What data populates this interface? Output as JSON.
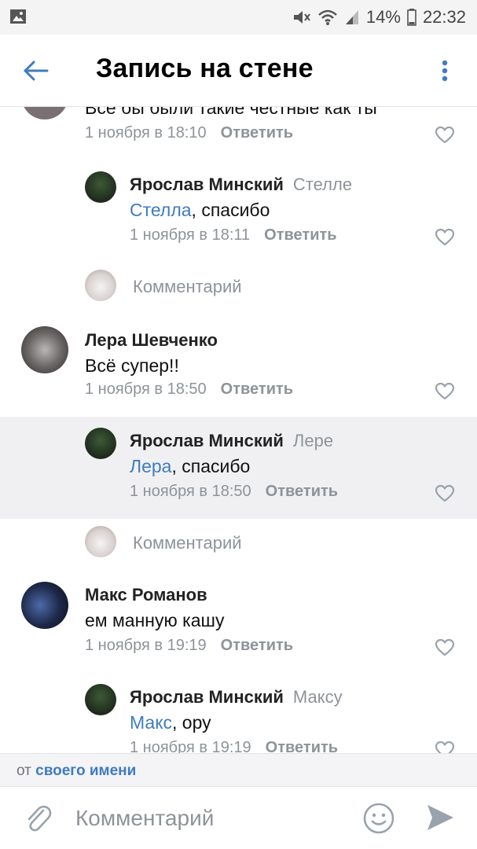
{
  "status_bar": {
    "battery": "14%",
    "time": "22:32"
  },
  "header": {
    "title": "Запись на стене"
  },
  "comments": [
    {
      "text": "Все бы были такие честные как ты",
      "date": "1 ноября в 18:10",
      "reply": "Ответить"
    },
    {
      "author": "Ярослав Минский",
      "reply_to": "Стелле",
      "mention": "Стелла",
      "text": ", спасибо",
      "date": "1 ноября в 18:11",
      "reply": "Ответить"
    },
    {
      "placeholder": "Комментарий"
    },
    {
      "author": "Лера Шевченко",
      "text": "Всё супер!!",
      "date": "1 ноября в 18:50",
      "reply": "Ответить"
    },
    {
      "author": "Ярослав Минский",
      "reply_to": "Лере",
      "mention": "Лера",
      "text": ", спасибо",
      "date": "1 ноября в 18:50",
      "reply": "Ответить"
    },
    {
      "placeholder": "Комментарий"
    },
    {
      "author": "Макс Романов",
      "text": "ем манную кашу",
      "date": "1 ноября в 19:19",
      "reply": "Ответить"
    },
    {
      "author": "Ярослав Минский",
      "reply_to": "Максу",
      "mention": "Макс",
      "text": ", ору",
      "date": "1 ноября в 19:19",
      "reply": "Ответить"
    }
  ],
  "footer": {
    "prefix": "от",
    "owner": "своего имени"
  },
  "composer": {
    "placeholder": "Комментарий"
  },
  "colors": {
    "accent": "#3f7bc1",
    "muted": "#8e9399",
    "highlight_bg": "#f0f0f2"
  },
  "icons": [
    "image-icon",
    "mute-icon",
    "wifi-icon",
    "signal-icon",
    "battery-icon",
    "back-arrow-icon",
    "more-vertical-icon",
    "heart-icon",
    "attach-icon",
    "emoji-icon",
    "send-icon"
  ]
}
